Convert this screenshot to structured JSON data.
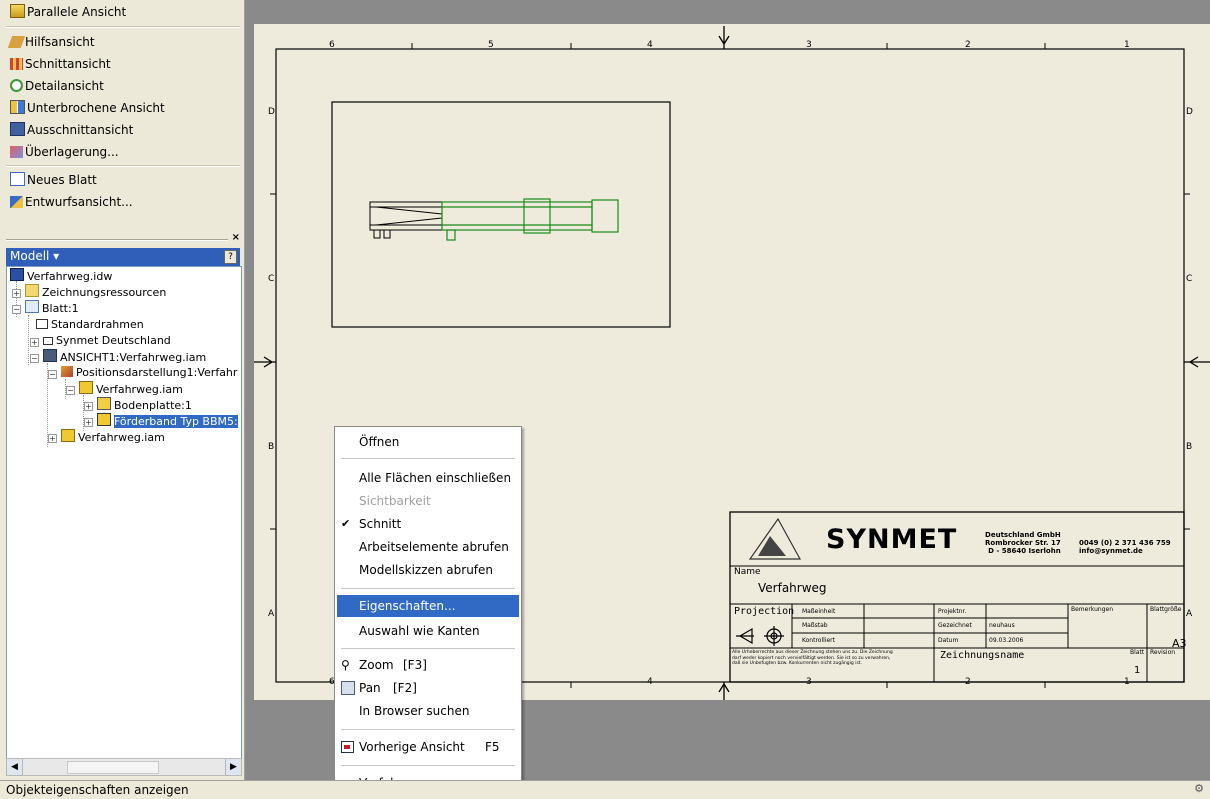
{
  "left_panel": {
    "commands_top": [
      {
        "label": "Parallele Ansicht"
      }
    ],
    "commands_views": [
      {
        "label": "Hilfsansicht"
      },
      {
        "label": "Schnittansicht"
      },
      {
        "label": "Detailansicht"
      },
      {
        "label": "Unterbrochene Ansicht"
      },
      {
        "label": "Ausschnittansicht"
      },
      {
        "label": "Überlagerung..."
      }
    ],
    "commands_sheet": [
      {
        "label": "Neues Blatt"
      },
      {
        "label": "Entwurfsansicht..."
      }
    ],
    "close_glyph": "×"
  },
  "browser": {
    "title": "Modell ▾",
    "help": "?",
    "tree": [
      {
        "label": "Verfahrweg.idw"
      },
      {
        "label": "Zeichnungsressourcen"
      },
      {
        "label": "Blatt:1"
      },
      {
        "label": "Standardrahmen"
      },
      {
        "label": "Synmet Deutschland"
      },
      {
        "label": "ANSICHT1:Verfahrweg.iam"
      },
      {
        "label": "Positionsdarstellung1:Verfahr"
      },
      {
        "label": "Verfahrweg.iam"
      },
      {
        "label": "Bodenplatte:1"
      },
      {
        "label": "Förderband Typ BBM5:"
      },
      {
        "label": "Verfahrweg.iam"
      }
    ]
  },
  "status_bar": {
    "text": "Objekteigenschaften anzeigen"
  },
  "drawing": {
    "col_labels": [
      "6",
      "5",
      "4",
      "3",
      "2",
      "1"
    ],
    "row_labels": [
      "D",
      "C",
      "B",
      "A"
    ],
    "title_block": {
      "company": "SYNMET",
      "addr_lines": [
        "Deutschland GmbH",
        "Rombrocker Str. 17",
        "D - 58640 Iserlohn"
      ],
      "contact_lines": [
        "0049 (0) 2 371 436 759",
        "info@synmet.de"
      ],
      "name_label": "Name",
      "name_value": "Verfahrweg",
      "projection": "Projection",
      "row1": [
        "Maßeinheit",
        "",
        "Projektnr.",
        "",
        "Bemerkungen",
        "Blattgröße"
      ],
      "row2": [
        "Maßstab",
        "",
        "Gezeichnet",
        "neuhaus"
      ],
      "row3": [
        "Kontrolliert",
        "",
        "Datum",
        "09.03.2006"
      ],
      "size": "A3",
      "copyright": [
        "Alle Urheberrechte aus dieser Zeichnung stehen uns zu. Die Zeichnung",
        "darf weder kopiert noch vervielfältigt werden. Sie ist so zu verwahren,",
        "daß sie Unbefugten bzw. Konkurrenten nicht zugängig ist."
      ],
      "drawing_name_label": "Zeichnungsname",
      "blatt_label": "Blatt",
      "revision_label": "Revision",
      "blatt_value": "1"
    }
  },
  "context_menu": {
    "items": [
      {
        "label": "Öffnen"
      },
      {
        "label": "Alle Flächen einschließen"
      },
      {
        "label": "Sichtbarkeit"
      },
      {
        "label": "Schnitt"
      },
      {
        "label": "Arbeitselemente abrufen"
      },
      {
        "label": "Modellskizzen abrufen"
      },
      {
        "label": "Eigenschaften..."
      },
      {
        "label": "Auswahl wie Kanten"
      },
      {
        "label": "Zoom",
        "shortcut": "[F3]"
      },
      {
        "label": "Pan",
        "shortcut": "[F2]"
      },
      {
        "label": "In Browser suchen"
      },
      {
        "label": "Vorherige Ansicht",
        "shortcut": "F5"
      },
      {
        "label": "Verfahren..."
      }
    ],
    "check_glyph": "✔"
  },
  "colors": {
    "highlight": "#316ac5",
    "model_black": "#000000",
    "model_green": "#1a8a1a",
    "browser_header": "#2f5fb8"
  }
}
